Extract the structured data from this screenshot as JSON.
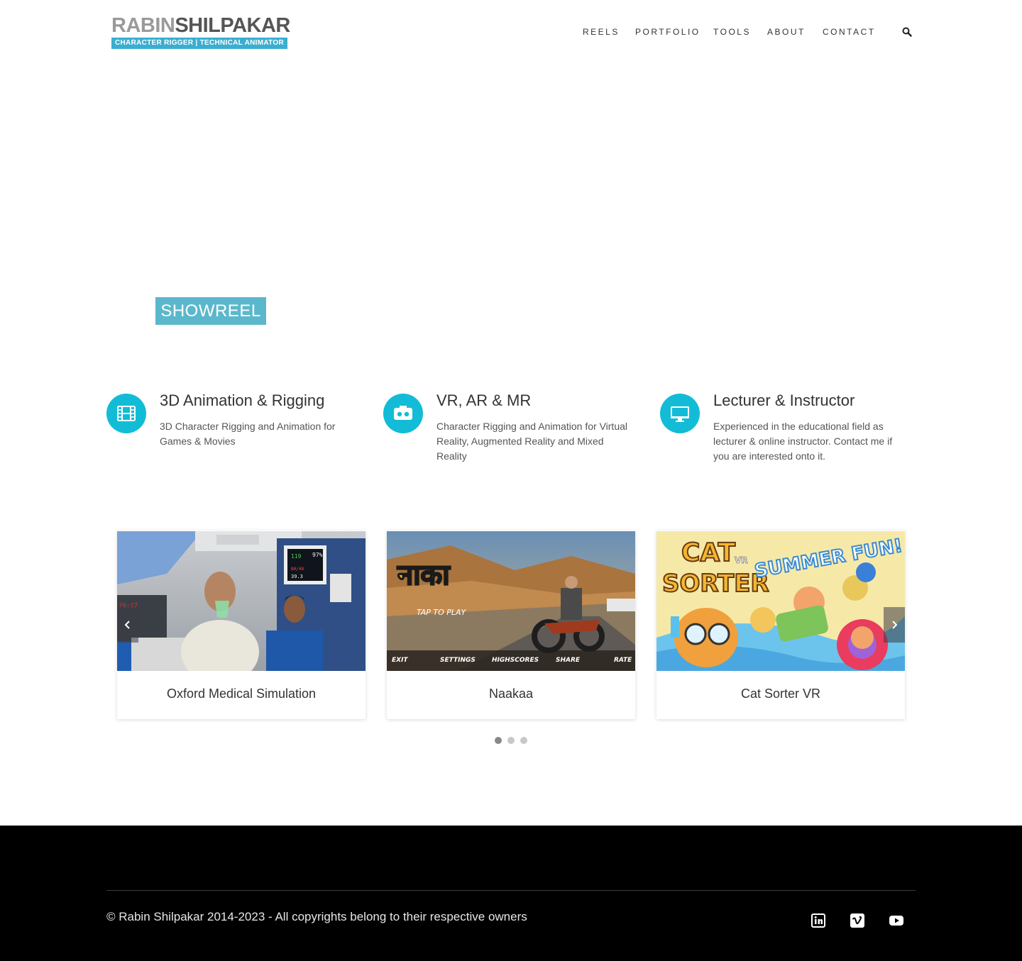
{
  "logo": {
    "name_part1": "RABIN",
    "name_part2": "SHILPAKAR",
    "tagline": "CHARACTER RIGGER | TECHNICAL ANIMATOR"
  },
  "nav": {
    "items": [
      {
        "label": "REELS"
      },
      {
        "label": "PORTFOLIO"
      },
      {
        "label": "TOOLS"
      },
      {
        "label": "ABOUT"
      },
      {
        "label": "CONTACT"
      }
    ],
    "search_icon": "search-icon"
  },
  "hero": {
    "button_label": "SHOWREEL",
    "button_color": "#5bb8cc"
  },
  "features": [
    {
      "icon": "film-icon",
      "title": "3D Animation & Rigging",
      "description": "3D Character Rigging and Animation for Games & Movies"
    },
    {
      "icon": "vr-headset-icon",
      "title": "VR, AR & MR",
      "description": "Character Rigging and Animation for Virtual Reality, Augmented Reality and Mixed Reality"
    },
    {
      "icon": "monitor-icon",
      "title": "Lecturer & Instructor",
      "description": "Experienced in the educational field as lecturer & online instructor. Contact me if you are interested onto it."
    }
  ],
  "feature_icon_color": "#12bcd6",
  "portfolio": {
    "cards": [
      {
        "title": "Oxford Medical Simulation",
        "image": "medical-simulation-thumbnail"
      },
      {
        "title": "Naakaa",
        "image": "naakaa-game-thumbnail",
        "game_title": "नाका",
        "tap_text": "TAP TO PLAY",
        "menu": [
          "EXIT",
          "SETTINGS",
          "HIGHSCORES",
          "SHARE",
          "RATE"
        ]
      },
      {
        "title": "Cat Sorter VR",
        "image": "cat-sorter-vr-thumbnail",
        "logo_text": [
          "CAT",
          "SORTER",
          "VR"
        ],
        "banner": "SUMMER FUN!"
      }
    ],
    "prev_icon": "chevron-left-icon",
    "next_icon": "chevron-right-icon",
    "dots": 3,
    "active_dot": 0
  },
  "footer": {
    "copyright": "© Rabin Shilpakar 2014-2023 - All copyrights belong to their respective owners",
    "social": [
      {
        "icon": "linkedin-icon"
      },
      {
        "icon": "vimeo-icon"
      },
      {
        "icon": "youtube-icon"
      }
    ]
  }
}
